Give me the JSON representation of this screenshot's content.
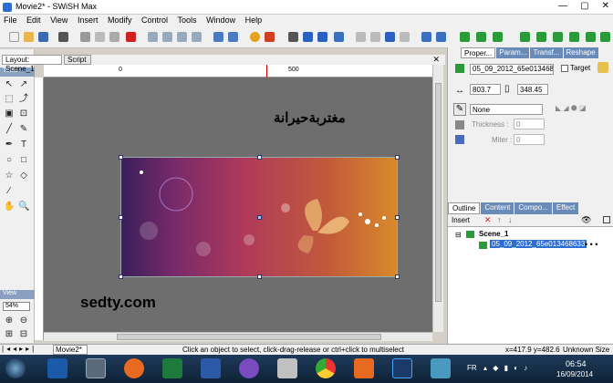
{
  "window": {
    "title": "Movie2* - SWiSH Max",
    "min": "—",
    "max": "▢",
    "close": "✕"
  },
  "menu": [
    "File",
    "Edit",
    "View",
    "Insert",
    "Modify",
    "Control",
    "Tools",
    "Window",
    "Help"
  ],
  "left_tabs": {
    "layout": "Layout: Scene_1",
    "script": "Script"
  },
  "ruler": {
    "zero": "0",
    "fivehundred": "500"
  },
  "stage_text": {
    "arabic": "مغتربةحيرانة",
    "watermark": "sedty.com"
  },
  "tools": {
    "header": "Tools",
    "view_header": "View",
    "zoom": "54%"
  },
  "right": {
    "tabs": [
      "Proper...",
      "Param...",
      "Transf...",
      "Reshape"
    ],
    "object_name": "05_09_2012_65e013468...",
    "target_label": "Target",
    "x": "803.7",
    "y": "348.45",
    "line_style": "None",
    "thickness_label": "Thickness :",
    "thickness": "0",
    "miter_label": "Miter :",
    "miter": "0",
    "outline_tabs": [
      "Outline",
      "Content",
      "Compo...",
      "Effect"
    ],
    "insert_label": "Insert",
    "scene": "Scene_1",
    "item": "05_09_2012_65e013468633"
  },
  "status": {
    "message": "Click an object to select, click-drag-release or ctrl+click to multiselect",
    "coords": "x=417.9 y=482.6",
    "size": "Unknown Size",
    "doc_tab": "Movie2*"
  },
  "clock": {
    "time": "06:54",
    "date": "16/09/2014",
    "lang": "FR"
  }
}
